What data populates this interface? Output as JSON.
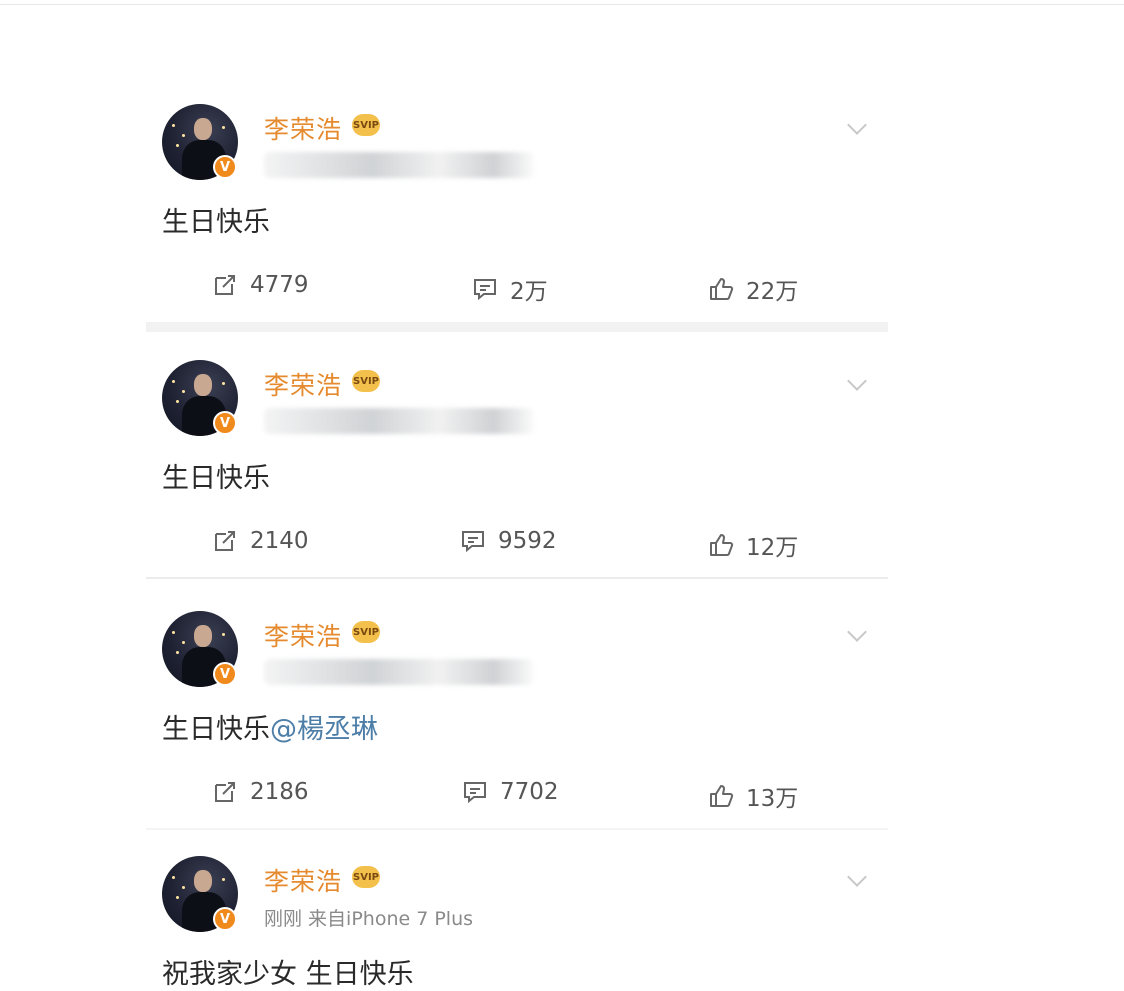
{
  "posts": [
    {
      "username": "李荣浩",
      "badge": "SVIP",
      "meta": "",
      "content": "生日快乐",
      "mention": "",
      "reposts": "4779",
      "comments": "2万",
      "likes": "22万"
    },
    {
      "username": "李荣浩",
      "badge": "SVIP",
      "meta": "",
      "content": "生日快乐",
      "mention": "",
      "reposts": "2140",
      "comments": "9592",
      "likes": "12万"
    },
    {
      "username": "李荣浩",
      "badge": "SVIP",
      "meta": "",
      "content": "生日快乐",
      "mention": "@楊丞琳",
      "reposts": "2186",
      "comments": "7702",
      "likes": "13万"
    },
    {
      "username": "李荣浩",
      "badge": "SVIP",
      "meta": "刚刚 来自iPhone 7 Plus",
      "content": "祝我家少女 生日快乐",
      "mention": "",
      "reposts": "",
      "comments": "",
      "likes": ""
    }
  ],
  "colors": {
    "username": "#e58a2e",
    "verified_badge": "#f08a1c",
    "mention": "#4d7ea8",
    "separator": "#f2f2f2"
  },
  "icons": {
    "repost": "repost-icon",
    "comment": "comment-icon",
    "like": "thumbs-up-icon",
    "more": "chevron-down-icon",
    "verified": "verified-v-icon"
  }
}
